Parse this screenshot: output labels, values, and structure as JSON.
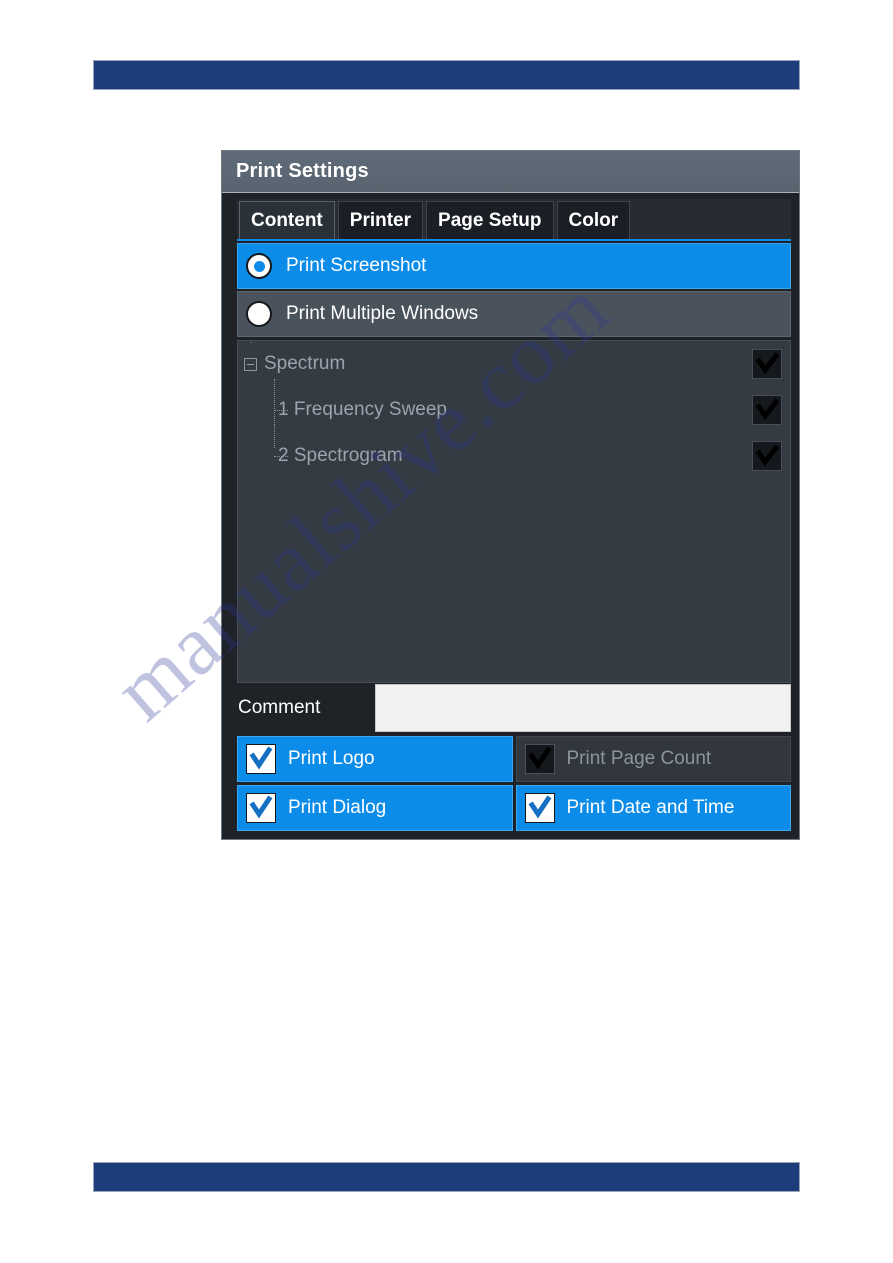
{
  "page": {
    "top_bar_color": "#1c3c7c",
    "bottom_bar_color": "#1c3c7c",
    "watermark_text": "manualshive.com"
  },
  "dialog": {
    "title": "Print Settings",
    "accent_color": "#0c8ce9",
    "titlebar_color": "#5f6b79",
    "tabs": [
      {
        "label": "Content",
        "active": true
      },
      {
        "label": "Printer",
        "active": false
      },
      {
        "label": "Page Setup",
        "active": false
      },
      {
        "label": "Color",
        "active": false
      }
    ],
    "print_mode": {
      "options": [
        {
          "label": "Print Screenshot",
          "selected": true
        },
        {
          "label": "Print Multiple Windows",
          "selected": false
        }
      ]
    },
    "window_tree": {
      "nodes": [
        {
          "label": "Spectrum",
          "level": 0,
          "expanded": true,
          "checked": true,
          "enabled": false
        },
        {
          "label": "1 Frequency Sweep",
          "level": 1,
          "expanded": false,
          "checked": true,
          "enabled": false
        },
        {
          "label": "2 Spectrogram",
          "level": 1,
          "expanded": false,
          "checked": true,
          "enabled": false
        }
      ]
    },
    "comment": {
      "label": "Comment",
      "value": "",
      "placeholder": ""
    },
    "options": [
      {
        "label": "Print Logo",
        "checked": true,
        "enabled": true
      },
      {
        "label": "Print Page Count",
        "checked": true,
        "enabled": false
      },
      {
        "label": "Print Dialog",
        "checked": true,
        "enabled": true
      },
      {
        "label": "Print Date and Time",
        "checked": true,
        "enabled": true
      }
    ]
  }
}
